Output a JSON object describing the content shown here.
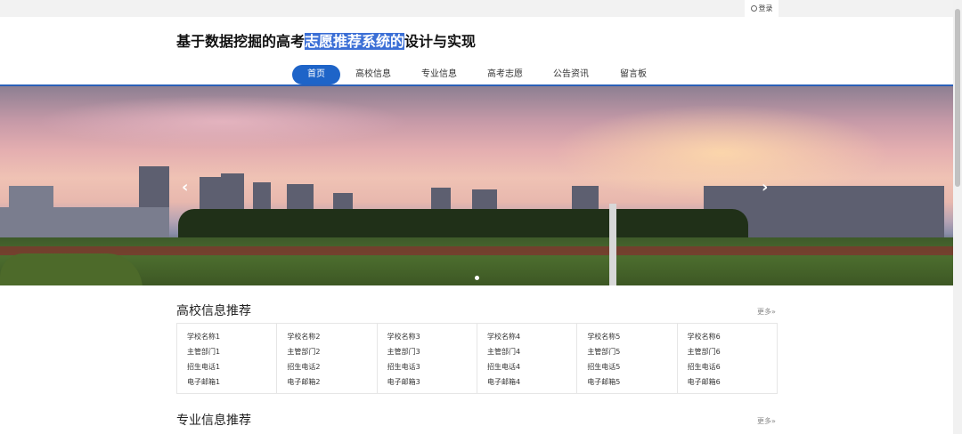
{
  "header": {
    "login_label": "登录",
    "title_before": "基于数据挖掘的高考",
    "title_highlight": "志愿推荐系统的",
    "title_after": "设计与实现"
  },
  "nav": {
    "items": [
      "首页",
      "高校信息",
      "专业信息",
      "高考志愿",
      "公告资讯",
      "留言板"
    ],
    "active_index": 0
  },
  "banner": {
    "prev_icon": "chevron-left-icon",
    "next_icon": "chevron-right-icon",
    "slide_count": 1,
    "active_slide": 0
  },
  "sections": {
    "colleges": {
      "title": "高校信息推荐",
      "more_label": "更多»",
      "cards": [
        {
          "name": "学校名称1",
          "dept": "主管部门1",
          "phone": "招生电话1",
          "email": "电子邮箱1"
        },
        {
          "name": "学校名称2",
          "dept": "主管部门2",
          "phone": "招生电话2",
          "email": "电子邮箱2"
        },
        {
          "name": "学校名称3",
          "dept": "主管部门3",
          "phone": "招生电话3",
          "email": "电子邮箱3"
        },
        {
          "name": "学校名称4",
          "dept": "主管部门4",
          "phone": "招生电话4",
          "email": "电子邮箱4"
        },
        {
          "name": "学校名称5",
          "dept": "主管部门5",
          "phone": "招生电话5",
          "email": "电子邮箱5"
        },
        {
          "name": "学校名称6",
          "dept": "主管部门6",
          "phone": "招生电话6",
          "email": "电子邮箱6"
        }
      ]
    },
    "majors": {
      "title": "专业信息推荐",
      "more_label": "更多»"
    }
  },
  "colors": {
    "accent": "#1e64c8",
    "title_highlight": "#3b6fd6"
  }
}
